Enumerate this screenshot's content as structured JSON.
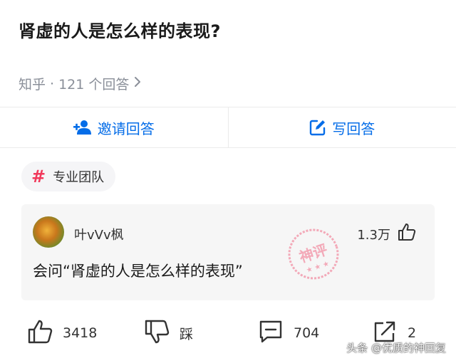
{
  "question": {
    "title": "肾虚的人是怎么样的表现?",
    "source": "知乎",
    "separator": "·",
    "answer_count": "121 个回答",
    "chevron_icon": "chevron-right-icon"
  },
  "actions": {
    "invite_label": "邀请回答",
    "invite_icon": "add-user-icon",
    "write_label": "写回答",
    "write_icon": "edit-icon"
  },
  "tag": {
    "label": "专业团队",
    "icon": "hash-icon"
  },
  "answer": {
    "author": "叶vVv枫",
    "votes": "1.3万",
    "excerpt": "会问“肾虚的人是怎么样的表现”",
    "seal_text": "神评"
  },
  "bottom_bar": {
    "like_count": "3418",
    "dislike_label": "踩",
    "comment_count": "704",
    "share_count": "2"
  },
  "watermark": "头条 @优质的神回复",
  "colors": {
    "accent": "#056de8",
    "tag_hash": "#f1395b",
    "seal": "#f06a86",
    "muted": "#8a8f99"
  }
}
